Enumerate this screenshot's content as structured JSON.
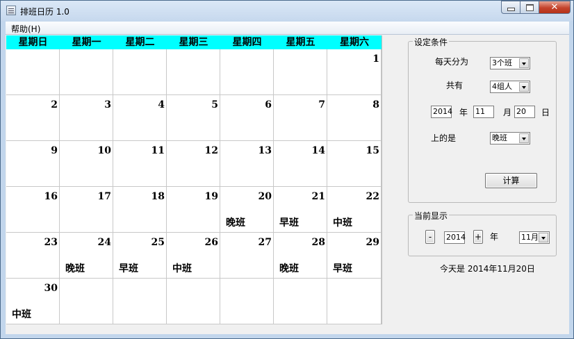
{
  "window": {
    "title": "排班日历 1.0"
  },
  "menu": {
    "help": "帮助(H)"
  },
  "calendar": {
    "weekdays": [
      "星期日",
      "星期一",
      "星期二",
      "星期三",
      "星期四",
      "星期五",
      "星期六"
    ],
    "weeks": [
      [
        {
          "day": "",
          "shift": ""
        },
        {
          "day": "",
          "shift": ""
        },
        {
          "day": "",
          "shift": ""
        },
        {
          "day": "",
          "shift": ""
        },
        {
          "day": "",
          "shift": ""
        },
        {
          "day": "",
          "shift": ""
        },
        {
          "day": "1",
          "shift": ""
        }
      ],
      [
        {
          "day": "2",
          "shift": ""
        },
        {
          "day": "3",
          "shift": ""
        },
        {
          "day": "4",
          "shift": ""
        },
        {
          "day": "5",
          "shift": ""
        },
        {
          "day": "6",
          "shift": ""
        },
        {
          "day": "7",
          "shift": ""
        },
        {
          "day": "8",
          "shift": ""
        }
      ],
      [
        {
          "day": "9",
          "shift": ""
        },
        {
          "day": "10",
          "shift": ""
        },
        {
          "day": "11",
          "shift": ""
        },
        {
          "day": "12",
          "shift": ""
        },
        {
          "day": "13",
          "shift": ""
        },
        {
          "day": "14",
          "shift": ""
        },
        {
          "day": "15",
          "shift": ""
        }
      ],
      [
        {
          "day": "16",
          "shift": ""
        },
        {
          "day": "17",
          "shift": ""
        },
        {
          "day": "18",
          "shift": ""
        },
        {
          "day": "19",
          "shift": ""
        },
        {
          "day": "20",
          "shift": "晚班"
        },
        {
          "day": "21",
          "shift": "早班"
        },
        {
          "day": "22",
          "shift": "中班"
        }
      ],
      [
        {
          "day": "23",
          "shift": ""
        },
        {
          "day": "24",
          "shift": "晚班"
        },
        {
          "day": "25",
          "shift": "早班"
        },
        {
          "day": "26",
          "shift": "中班"
        },
        {
          "day": "27",
          "shift": ""
        },
        {
          "day": "28",
          "shift": "晚班"
        },
        {
          "day": "29",
          "shift": "早班"
        }
      ],
      [
        {
          "day": "30",
          "shift": "中班"
        },
        {
          "day": "",
          "shift": ""
        },
        {
          "day": "",
          "shift": ""
        },
        {
          "day": "",
          "shift": ""
        },
        {
          "day": "",
          "shift": ""
        },
        {
          "day": "",
          "shift": ""
        },
        {
          "day": "",
          "shift": ""
        }
      ]
    ],
    "header_color": "#00ffff"
  },
  "settings": {
    "legend": "设定条件",
    "per_day_label": "每天分为",
    "per_day_value": "3个班",
    "total_label": "共有",
    "total_value": "4组人",
    "start_year": "2014",
    "year_unit": "年",
    "start_month": "11",
    "month_unit": "月",
    "start_day": "20",
    "day_unit": "日",
    "shift_label": "上的是",
    "shift_value": "晚班",
    "calc_button": "计算"
  },
  "display": {
    "legend": "当前显示",
    "minus": "-",
    "year": "2014",
    "plus": "+",
    "year_unit": "年",
    "month_value": "11月"
  },
  "today": {
    "text": "今天是  2014年11月20日"
  }
}
